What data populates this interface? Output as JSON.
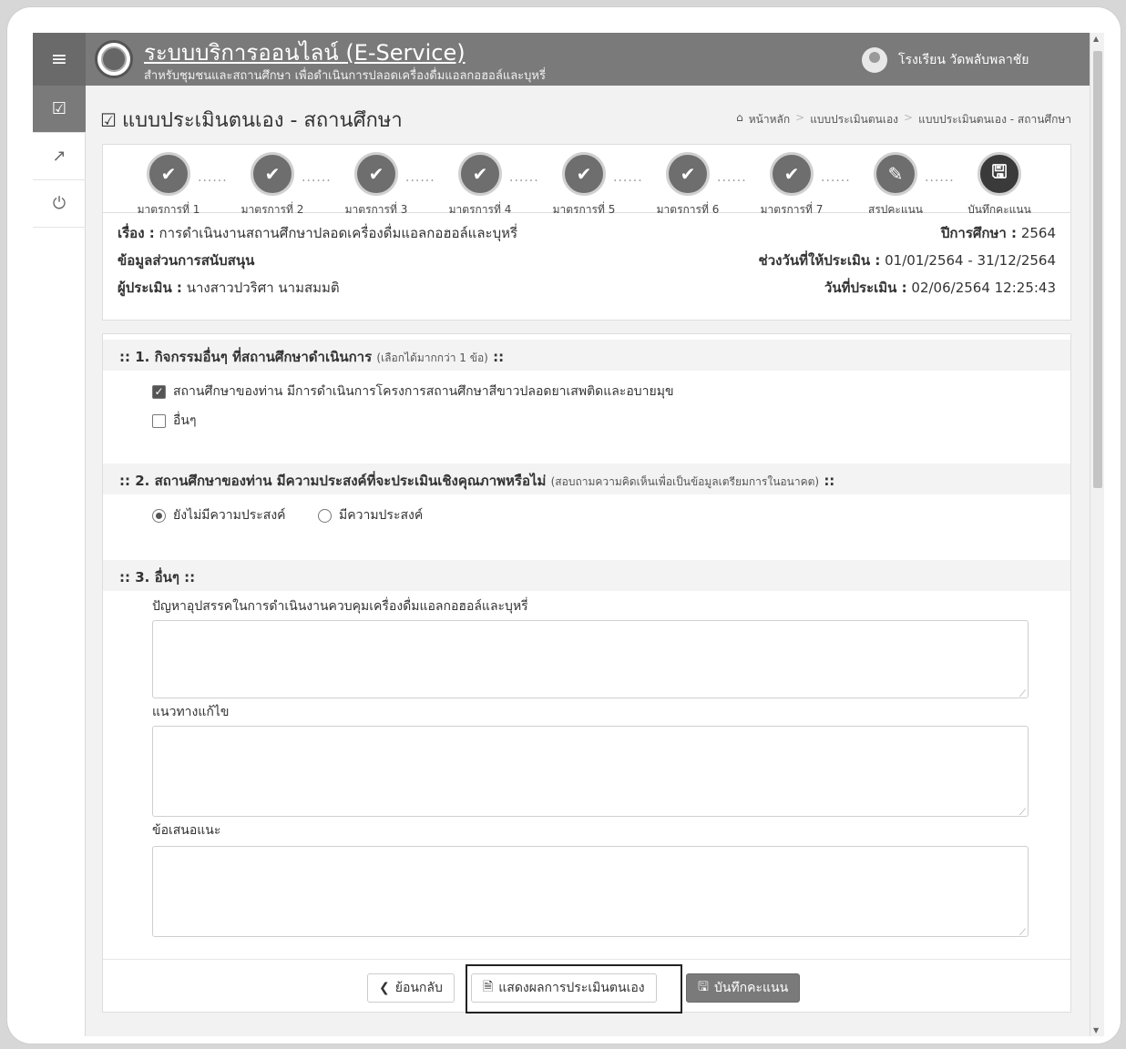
{
  "app": {
    "title": "ระบบบริการออนไลน์ (E-Service)",
    "subtitle": "สำหรับชุมชนและสถานศึกษา เพื่อดำเนินการปลอดเครื่องดื่มแอลกอฮอล์และบุหรี่",
    "user": "โรงเรียน วัดพลับพลาชัย"
  },
  "page": {
    "title": "แบบประเมินตนเอง - สถานศึกษา"
  },
  "breadcrumb": [
    "หน้าหลัก",
    "แบบประเมินตนเอง",
    "แบบประเมินตนเอง - สถานศึกษา"
  ],
  "steps": [
    {
      "label": "มาตรการที่ 1",
      "state": "done"
    },
    {
      "label": "มาตรการที่ 2",
      "state": "done"
    },
    {
      "label": "มาตรการที่ 3",
      "state": "done"
    },
    {
      "label": "มาตรการที่ 4",
      "state": "done"
    },
    {
      "label": "มาตรการที่ 5",
      "state": "done"
    },
    {
      "label": "มาตรการที่ 6",
      "state": "done"
    },
    {
      "label": "มาตรการที่ 7",
      "state": "done"
    },
    {
      "label": "สรุปคะแนน",
      "state": "edit"
    },
    {
      "label": "บันทึกคะแนน",
      "state": "save"
    }
  ],
  "info": {
    "subject_label": "เรื่อง :",
    "subject_value": "การดำเนินงานสถานศึกษาปลอดเครื่องดื่มแอลกอฮอล์และบุหรี่",
    "year_label": "ปีการศึกษา :",
    "year_value": "2564",
    "support_label": "ข้อมูลส่วนการสนับสนุน",
    "period_label": "ช่วงวันที่ให้ประเมิน :",
    "period_value": "01/01/2564 - 31/12/2564",
    "assessor_label": "ผู้ประเมิน :",
    "assessor_value": "นางสาวปวริศา นามสมมติ",
    "date_label": "วันที่ประเมิน :",
    "date_value": "02/06/2564 12:25:43"
  },
  "section1": {
    "title": ":: 1. กิจกรรมอื่นๆ ที่สถานศึกษาดำเนินการ",
    "note": "(เลือกได้มากกว่า 1 ข้อ)",
    "suffix": "::",
    "options": [
      {
        "label": "สถานศึกษาของท่าน มีการดำเนินการโครงการสถานศึกษาสีขาวปลอดยาเสพติดและอบายมุข",
        "checked": true
      },
      {
        "label": "อื่นๆ",
        "checked": false
      }
    ]
  },
  "section2": {
    "title": ":: 2. สถานศึกษาของท่าน มีความประสงค์ที่จะประเมินเชิงคุณภาพหรือไม่",
    "note": "(สอบถามความคิดเห็นเพื่อเป็นข้อมูลเตรียมการในอนาคต)",
    "suffix": "::",
    "options": [
      {
        "label": "ยังไม่มีความประสงค์",
        "selected": true
      },
      {
        "label": "มีความประสงค์",
        "selected": false
      }
    ]
  },
  "section3": {
    "title": ":: 3. อื่นๆ ::",
    "fields": [
      {
        "label": "ปัญหาอุปสรรคในการดำเนินงานควบคุมเครื่องดื่มแอลกอฮอล์และบุหรี่",
        "value": ""
      },
      {
        "label": "แนวทางแก้ไข",
        "value": ""
      },
      {
        "label": "ข้อเสนอแนะ",
        "value": ""
      }
    ]
  },
  "buttons": {
    "back": "ย้อนกลับ",
    "show": "แสดงผลการประเมินตนเอง",
    "save": "บันทึกคะแนน"
  }
}
